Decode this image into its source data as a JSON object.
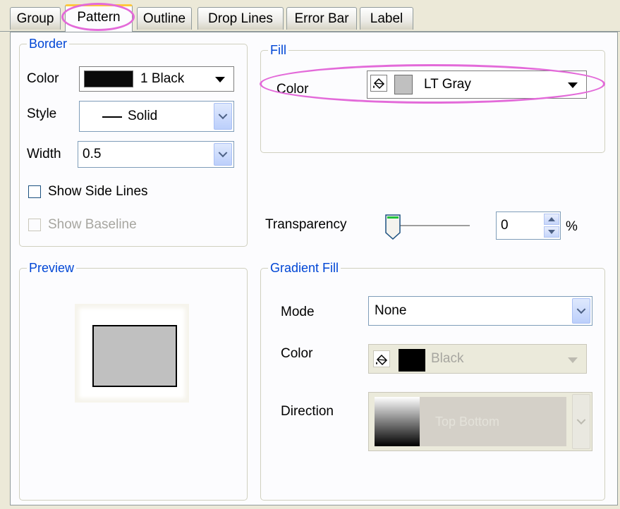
{
  "tabs": [
    {
      "label": "Group"
    },
    {
      "label": "Pattern"
    },
    {
      "label": "Outline"
    },
    {
      "label": "Drop Lines"
    },
    {
      "label": "Error Bar"
    },
    {
      "label": "Label"
    }
  ],
  "active_tab": "Pattern",
  "border": {
    "title": "Border",
    "color_label": "Color",
    "color_value": "1 Black",
    "style_label": "Style",
    "style_value": "Solid",
    "width_label": "Width",
    "width_value": "0.5",
    "show_side_lines": "Show Side Lines",
    "show_baseline": "Show Baseline"
  },
  "fill": {
    "title": "Fill",
    "color_label": "Color",
    "color_value": "LT Gray"
  },
  "transparency": {
    "label": "Transparency",
    "value": "0",
    "unit": "%",
    "slider_level": 0
  },
  "preview": {
    "title": "Preview"
  },
  "gradient": {
    "title": "Gradient Fill",
    "mode_label": "Mode",
    "mode_value": "None",
    "color_label": "Color",
    "color_value": "Black",
    "direction_label": "Direction",
    "direction_value": "Top Bottom"
  },
  "colors": {
    "highlight": "#e36ad9",
    "group_title": "#0046d5",
    "fill_color": "#c0c0c0",
    "border_color": "#000000"
  }
}
